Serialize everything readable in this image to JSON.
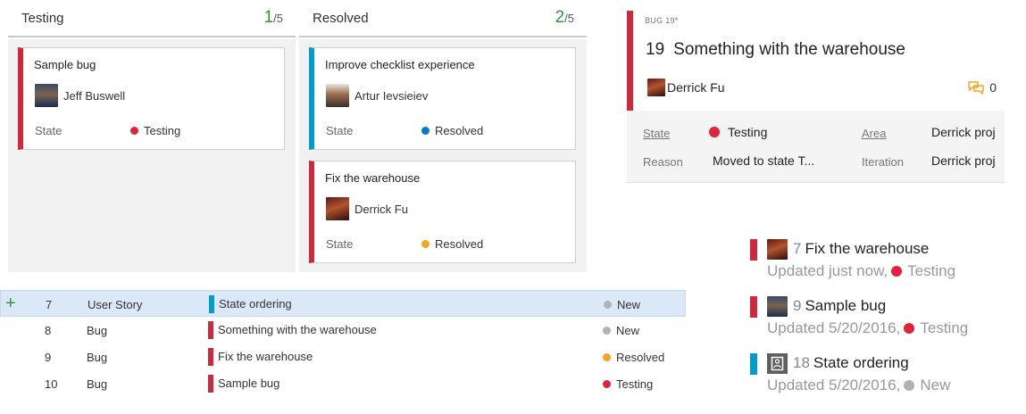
{
  "board": {
    "columns": [
      {
        "title": "Testing",
        "count_current": "1",
        "count_limit": "/5",
        "cards": [
          {
            "title": "Sample bug",
            "person": "Jeff Buswell",
            "state_label": "State",
            "state": "Testing",
            "state_color": "#e0223a",
            "type": "bug"
          }
        ]
      },
      {
        "title": "Resolved",
        "count_current": "2",
        "count_limit": "/5",
        "cards": [
          {
            "title": "Improve checklist experience",
            "person": "Artur Ievsieiev",
            "state_label": "State",
            "state": "Resolved",
            "state_color": "#007acc",
            "type": "story"
          },
          {
            "title": "Fix the warehouse",
            "person": "Derrick Fu",
            "state_label": "State",
            "state": "Resolved",
            "state_color": "#f2a31f",
            "type": "bug"
          }
        ]
      }
    ]
  },
  "work_item": {
    "type_label": "BUG 19*",
    "id": "19",
    "title": "Something with the warehouse",
    "assigned_to": "Derrick Fu",
    "comment_count": "0",
    "fields": {
      "state_label": "State",
      "state_value": "Testing",
      "reason_label": "Reason",
      "reason_value": "Moved to state T...",
      "area_label": "Area",
      "area_value": "Derrick proj",
      "iteration_label": "Iteration",
      "iteration_value": "Derrick proj"
    }
  },
  "grid": {
    "add_glyph": "+",
    "rows": [
      {
        "id": "7",
        "type": "User Story",
        "title": "State ordering",
        "state": "New",
        "kind": "story"
      },
      {
        "id": "8",
        "type": "Bug",
        "title": "Something with the warehouse",
        "state": "New",
        "kind": "bug"
      },
      {
        "id": "9",
        "type": "Bug",
        "title": "Fix the warehouse",
        "state": "Resolved",
        "kind": "bug"
      },
      {
        "id": "10",
        "type": "Bug",
        "title": "Sample bug",
        "state": "Testing",
        "kind": "bug"
      }
    ]
  },
  "recent": [
    {
      "id": "7",
      "title": "Fix the warehouse",
      "updated": "Updated just now,",
      "state": "Testing"
    },
    {
      "id": "9",
      "title": "Sample bug",
      "updated": "Updated 5/20/2016,",
      "state": "Testing"
    },
    {
      "id": "18",
      "title": "State ordering",
      "updated": "Updated 5/20/2016,",
      "state": "New"
    }
  ],
  "colors": {
    "bug": "#cc293d",
    "story": "#009ccc",
    "testing": "#e0223a",
    "resolved_blue": "#007acc",
    "resolved_orange": "#f2a31f",
    "new": "#b2b2b2",
    "wip_count": "#339933"
  }
}
